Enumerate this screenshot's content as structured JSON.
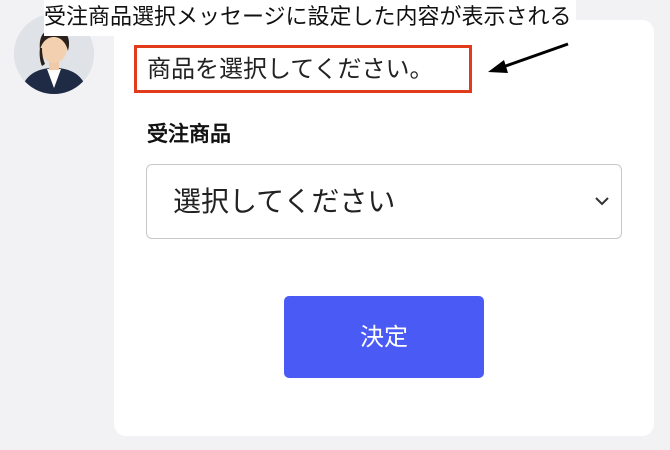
{
  "annotation": {
    "callout_text": "受注商品選択メッセージに設定した内容が表示される",
    "highlight_color": "#e23b1c"
  },
  "chat": {
    "avatar_icon": "person-avatar-icon",
    "message": "商品を選択してください。"
  },
  "form": {
    "field_label": "受注商品",
    "select": {
      "selected_value": "選択してください",
      "icon": "chevron-down-icon"
    },
    "submit_label": "決定",
    "accent_color": "#4a5af5"
  }
}
